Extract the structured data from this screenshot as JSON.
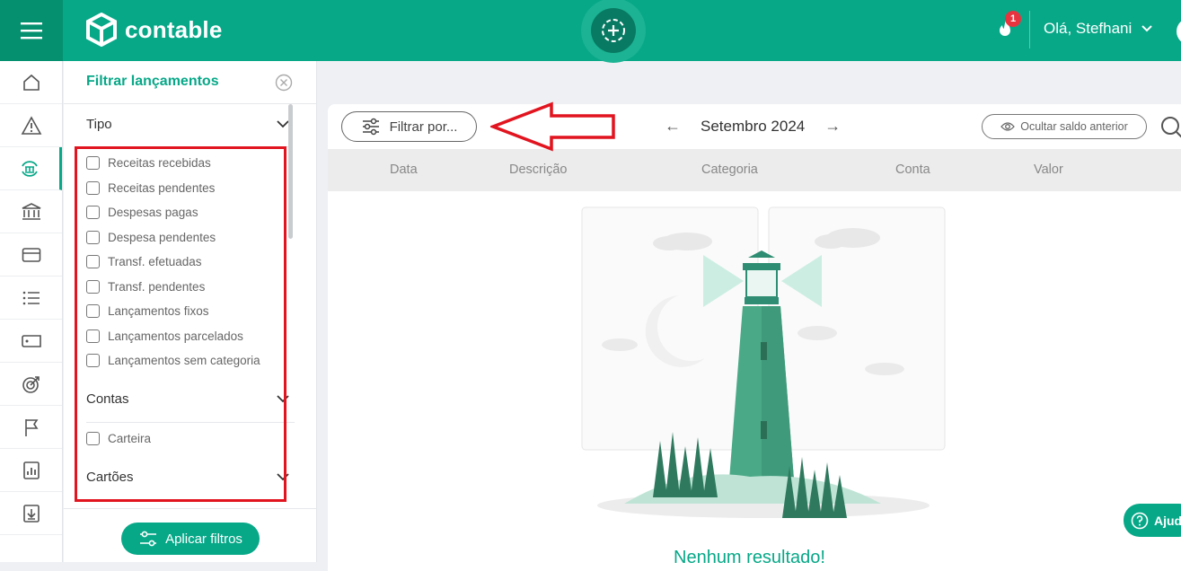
{
  "brand": {
    "name": "contable",
    "primary": "#07a888",
    "dark": "#05906f",
    "alert": "#e8343f"
  },
  "header": {
    "notification_count": "1",
    "greeting": "Olá, Stefhani"
  },
  "sidebar": {
    "items": [
      {
        "icon": "home-icon"
      },
      {
        "icon": "alert-icon"
      },
      {
        "icon": "transactions-icon",
        "active": true
      },
      {
        "icon": "bank-icon"
      },
      {
        "icon": "card-icon"
      },
      {
        "icon": "list-icon"
      },
      {
        "icon": "tag-icon"
      },
      {
        "icon": "target-icon"
      },
      {
        "icon": "flag-icon"
      },
      {
        "icon": "report-icon"
      },
      {
        "icon": "download-icon"
      }
    ]
  },
  "filter_panel": {
    "title": "Filtrar lançamentos",
    "tipo": {
      "label": "Tipo",
      "options": [
        "Receitas recebidas",
        "Receitas pendentes",
        "Despesas pagas",
        "Despesa pendentes",
        "Transf. efetuadas",
        "Transf. pendentes",
        "Lançamentos fixos",
        "Lançamentos parcelados",
        "Lançamentos sem categoria"
      ]
    },
    "contas": {
      "label": "Contas",
      "options": [
        "Carteira"
      ]
    },
    "cartoes": {
      "label": "Cartões"
    },
    "apply_label": "Aplicar filtros"
  },
  "main": {
    "filter_button": "Filtrar por...",
    "month": "Setembro 2024",
    "hide_balance": "Ocultar saldo anterior",
    "columns": [
      "Data",
      "Descrição",
      "Categoria",
      "Conta",
      "Valor"
    ],
    "empty_title": "Nenhum resultado!",
    "help_label": "Ajuda"
  }
}
